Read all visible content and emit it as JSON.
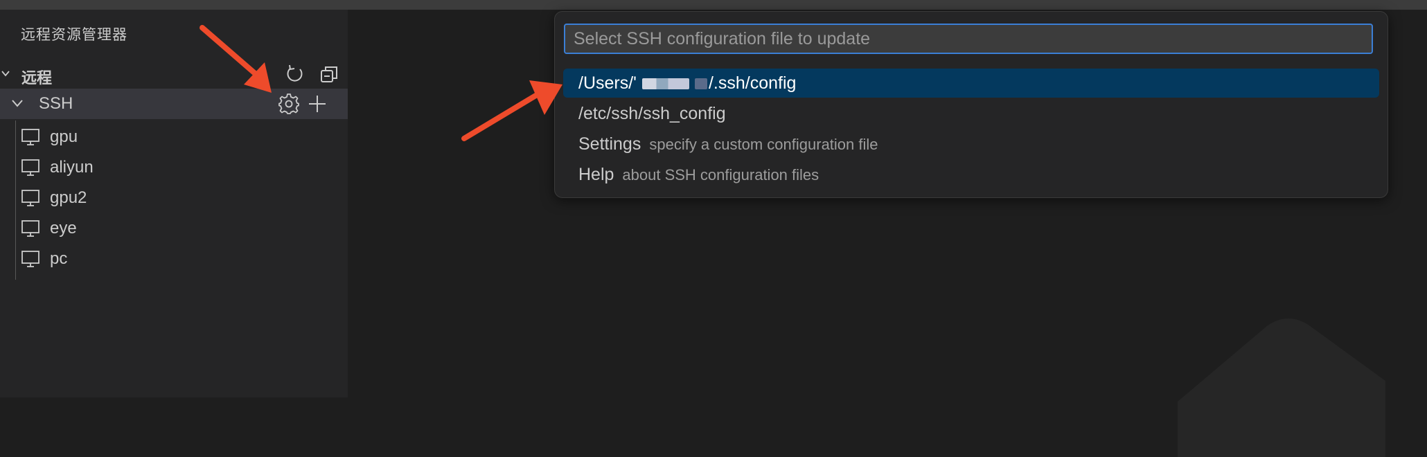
{
  "sidebar": {
    "title": "远程资源管理器",
    "section": {
      "title": "远程"
    },
    "ssh": {
      "label": "SSH"
    },
    "hosts": [
      "gpu",
      "aliyun",
      "gpu2",
      "eye",
      "pc"
    ]
  },
  "quickpick": {
    "placeholder": "Select SSH configuration file to update",
    "items": [
      {
        "label_prefix": "/Users/'",
        "label_suffix": "/.ssh/config",
        "selected": true
      },
      {
        "label": "/etc/ssh/ssh_config"
      },
      {
        "label": "Settings",
        "description": "specify a custom configuration file"
      },
      {
        "label": "Help",
        "description": "about SSH configuration files"
      }
    ]
  },
  "colors": {
    "sidebar_bg": "#252526",
    "editor_bg": "#1e1e1e",
    "selection": "#04395e",
    "focus_border": "#3b7fd6",
    "annotation_arrow": "#ee4b2b"
  },
  "icons": [
    "chevron-down-icon",
    "refresh-icon",
    "collapse-all-icon",
    "gear-icon",
    "plus-icon",
    "monitor-icon"
  ]
}
